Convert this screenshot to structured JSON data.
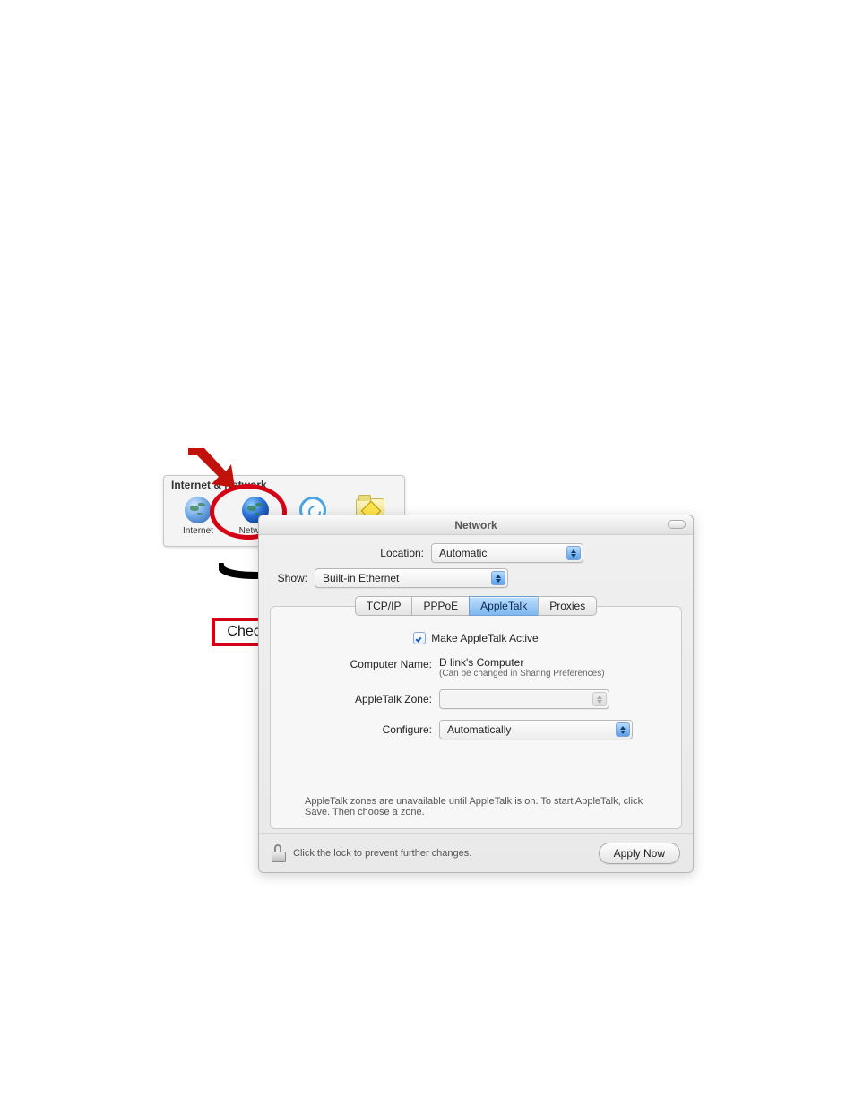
{
  "prefs": {
    "section_header": "Internet & Network",
    "items": [
      {
        "label": "Internet"
      },
      {
        "label": "Network"
      },
      {
        "label": "QuickTime"
      },
      {
        "label": "Sharing"
      }
    ]
  },
  "callout": {
    "text": "Check this option."
  },
  "window": {
    "title": "Network",
    "location": {
      "label": "Location:",
      "value": "Automatic"
    },
    "show": {
      "label": "Show:",
      "value": "Built-in Ethernet"
    },
    "tabs": [
      {
        "label": "TCP/IP"
      },
      {
        "label": "PPPoE"
      },
      {
        "label": "AppleTalk"
      },
      {
        "label": "Proxies"
      }
    ],
    "appletalk": {
      "make_active_label": "Make AppleTalk Active",
      "computer_name_label": "Computer Name:",
      "computer_name_value": "D link's Computer",
      "computer_name_note": "(Can be changed in Sharing Preferences)",
      "zone_label": "AppleTalk Zone:",
      "zone_value": "",
      "configure_label": "Configure:",
      "configure_value": "Automatically",
      "hint": "AppleTalk zones are unavailable until AppleTalk is on. To start AppleTalk, click Save. Then choose a zone."
    },
    "lock_text": "Click the lock to prevent further changes.",
    "apply_label": "Apply Now"
  }
}
